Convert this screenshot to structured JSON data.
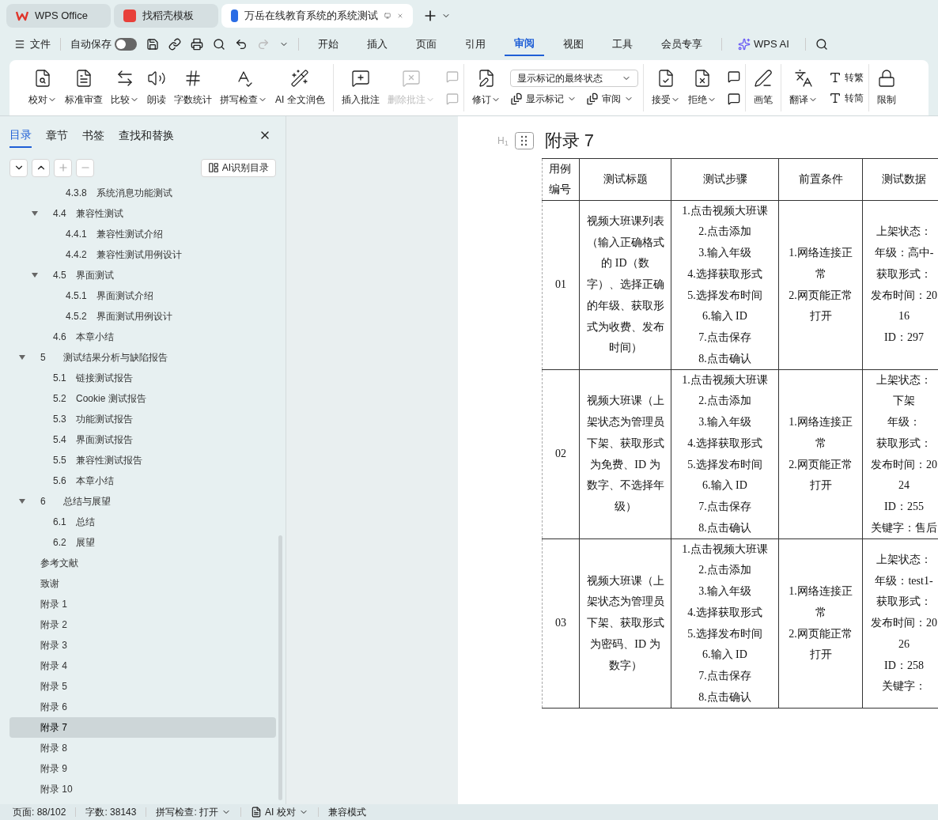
{
  "app_tabs": [
    {
      "label": "WPS Office",
      "selected": false,
      "kind": "home"
    },
    {
      "label": "找稻壳模板",
      "selected": false,
      "kind": "template"
    },
    {
      "label": "万岳在线教育系统的系统测试",
      "selected": true,
      "kind": "doc"
    }
  ],
  "menu": {
    "file": "文件",
    "autosave": {
      "label": "自动保存",
      "on": false
    },
    "tabs": [
      {
        "label": "开始",
        "selected": false
      },
      {
        "label": "插入",
        "selected": false
      },
      {
        "label": "页面",
        "selected": false
      },
      {
        "label": "引用",
        "selected": false
      },
      {
        "label": "审阅",
        "selected": true
      },
      {
        "label": "视图",
        "selected": false
      },
      {
        "label": "工具",
        "selected": false
      },
      {
        "label": "会员专享",
        "selected": false
      }
    ],
    "ai": "WPS AI"
  },
  "ribbon": {
    "groups": [
      {
        "items": [
          {
            "label": "校对",
            "dropdown": true,
            "disabled": false
          },
          {
            "label": "标准审查",
            "dropdown": false,
            "disabled": false
          },
          {
            "label": "比较",
            "dropdown": true,
            "disabled": false
          },
          {
            "label": "朗读",
            "dropdown": false,
            "disabled": false
          },
          {
            "label": "字数统计",
            "dropdown": false,
            "disabled": false
          },
          {
            "label": "拼写检查",
            "dropdown": true,
            "disabled": false
          },
          {
            "label": "AI 全文润色",
            "dropdown": false,
            "disabled": false
          }
        ]
      },
      {
        "items": [
          {
            "label": "插入批注",
            "dropdown": false,
            "disabled": false
          },
          {
            "label": "删除批注",
            "dropdown": true,
            "disabled": true
          }
        ],
        "small_icons": [
          {
            "disabled": true
          },
          {
            "disabled": true
          }
        ]
      },
      {
        "items": [
          {
            "label": "修订",
            "dropdown": true,
            "disabled": false
          }
        ],
        "select": "显示标记的最终状态",
        "sub": [
          {
            "label": "显示标记",
            "dropdown": true
          },
          {
            "label": "审阅",
            "dropdown": true
          }
        ]
      },
      {
        "items": [
          {
            "label": "接受",
            "dropdown": true,
            "disabled": false
          },
          {
            "label": "拒绝",
            "dropdown": true,
            "disabled": false
          }
        ],
        "small_icons": [
          {
            "disabled": false
          },
          {
            "disabled": false
          }
        ]
      },
      {
        "items": [
          {
            "label": "画笔",
            "dropdown": false,
            "disabled": false
          }
        ]
      },
      {
        "items": [
          {
            "label": "翻译",
            "dropdown": true,
            "disabled": false
          }
        ],
        "pair": [
          "转繁",
          "转简"
        ]
      },
      {
        "items": [
          {
            "label": "限制",
            "dropdown": false,
            "disabled": false
          }
        ]
      }
    ]
  },
  "nav": {
    "tabs": [
      {
        "label": "目录",
        "selected": true
      },
      {
        "label": "章节",
        "selected": false
      },
      {
        "label": "书签",
        "selected": false
      },
      {
        "label": "查找和替换",
        "selected": false
      }
    ],
    "ai_button": "AI识别目录",
    "toc": [
      {
        "children": [
          {
            "children": [
              {
                "number": "4.3.8",
                "title": "系统消息功能测试",
                "selected": false
              }
            ]
          },
          {
            "number": "4.4",
            "title": "兼容性测试",
            "expanded": true,
            "selected": false,
            "children": [
              {
                "number": "4.4.1",
                "title": "兼容性测试介绍",
                "selected": false
              },
              {
                "number": "4.4.2",
                "title": "兼容性测试用例设计",
                "selected": false
              }
            ]
          },
          {
            "number": "4.5",
            "title": "界面测试",
            "expanded": true,
            "selected": false,
            "children": [
              {
                "number": "4.5.1",
                "title": "界面测试介绍",
                "selected": false
              },
              {
                "number": "4.5.2",
                "title": "界面测试用例设计",
                "selected": false
              }
            ]
          },
          {
            "number": "4.6",
            "title": "本章小结",
            "selected": false
          }
        ]
      },
      {
        "number": "5",
        "title": "测试结果分析与缺陷报告",
        "expanded": true,
        "selected": false,
        "children": [
          {
            "number": "5.1",
            "title": "链接测试报告",
            "selected": false
          },
          {
            "number": "5.2",
            "title": "Cookie 测试报告",
            "selected": false
          },
          {
            "number": "5.3",
            "title": "功能测试报告",
            "selected": false
          },
          {
            "number": "5.4",
            "title": "界面测试报告",
            "selected": false
          },
          {
            "number": "5.5",
            "title": "兼容性测试报告",
            "selected": false
          },
          {
            "number": "5.6",
            "title": "本章小结",
            "selected": false
          }
        ]
      },
      {
        "number": "6",
        "title": "总结与展望",
        "expanded": true,
        "selected": false,
        "children": [
          {
            "number": "6.1",
            "title": "总结",
            "selected": false
          },
          {
            "number": "6.2",
            "title": "展望",
            "selected": false
          }
        ]
      },
      {
        "title": "参考文献",
        "selected": false
      },
      {
        "title": "致谢",
        "selected": false
      },
      {
        "title": "附录 1",
        "selected": false
      },
      {
        "title": "附录 2",
        "selected": false
      },
      {
        "title": "附录 3",
        "selected": false
      },
      {
        "title": "附录 4",
        "selected": false
      },
      {
        "title": "附录 5",
        "selected": false
      },
      {
        "title": "附录 6",
        "selected": false
      },
      {
        "title": "附录 7",
        "selected": true
      },
      {
        "title": "附录 8",
        "selected": false
      },
      {
        "title": "附录 9",
        "selected": false
      },
      {
        "title": "附录 10",
        "selected": false
      }
    ]
  },
  "document": {
    "heading_marker": "H$_{1}$",
    "heading": "附录 7",
    "table": {
      "columns": [
        "用例编号",
        "测试标题",
        "测试步骤",
        "前置条件",
        "测试数据"
      ],
      "rows": [
        {
          "id": "01",
          "title": "视频大班课列表（输入正确格式的 ID（数字）、选择正确的年级、获取形式为收费、发布时间）",
          "steps": [
            "1.点击视频大班课",
            "2.点击添加",
            "3.输入年级",
            "4.选择获取形式",
            "5.选择发布时间",
            "6.输入 ID",
            "7.点击保存",
            "8.点击确认"
          ],
          "preconditions": [
            "1.网络连接正常",
            "2.网页能正常打开"
          ],
          "data": [
            "上架状态：",
            "年级：高中-",
            "获取形式：",
            "发布时间：20",
            "16",
            "ID：297"
          ]
        },
        {
          "id": "02",
          "title": "视频大班课（上架状态为管理员下架、获取形式为免费、ID 为数字、不选择年级）",
          "steps": [
            "1.点击视频大班课",
            "2.点击添加",
            "3.输入年级",
            "4.选择获取形式",
            "5.选择发布时间",
            "6.输入 ID",
            "7.点击保存",
            "8.点击确认"
          ],
          "preconditions": [
            "1.网络连接正常",
            "2.网页能正常打开"
          ],
          "data": [
            "上架状态：",
            "下架",
            "年级：",
            "获取形式：",
            "发布时间：20",
            "24",
            "ID：255",
            "关键字：售后"
          ]
        },
        {
          "id": "03",
          "title": "视频大班课（上架状态为管理员下架、获取形式为密码、ID 为数字）",
          "steps": [
            "1.点击视频大班课",
            "2.点击添加",
            "3.输入年级",
            "4.选择获取形式",
            "5.选择发布时间",
            "6.输入 ID",
            "7.点击保存",
            "8.点击确认"
          ],
          "preconditions": [
            "1.网络连接正常",
            "2.网页能正常打开"
          ],
          "data": [
            "上架状态：",
            "年级：test1-",
            "获取形式：",
            "发布时间：20",
            "26",
            "ID：258",
            "关键字："
          ]
        }
      ]
    }
  },
  "status_bar": {
    "page": "页面: 88/102",
    "words": "字数: 38143",
    "spell": "拼写检查: 打开",
    "ai_check": "AI 校对",
    "mode": "兼容模式"
  }
}
